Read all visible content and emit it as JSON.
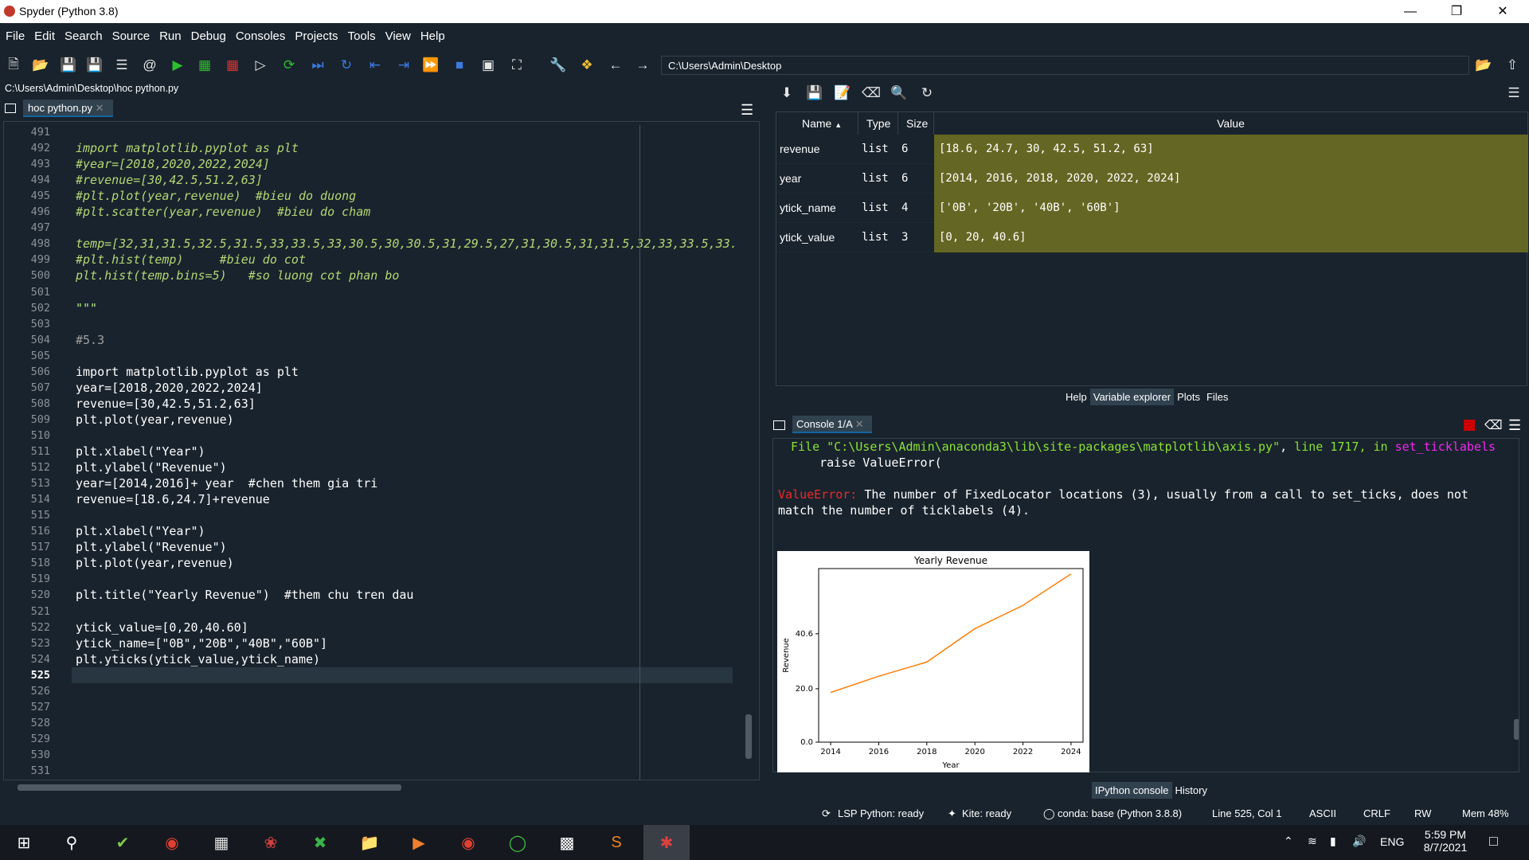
{
  "window": {
    "title": "Spyder (Python 3.8)",
    "minimize": "—",
    "restore": "❐",
    "close": "✕"
  },
  "menu": [
    "File",
    "Edit",
    "Search",
    "Source",
    "Run",
    "Debug",
    "Consoles",
    "Projects",
    "Tools",
    "View",
    "Help"
  ],
  "toolbar": {
    "path": "C:\\Users\\Admin\\Desktop"
  },
  "editor": {
    "file_path": "C:\\Users\\Admin\\Desktop\\hoc python.py",
    "tab_label": "hoc python.py",
    "line_numbers": [
      "491",
      "492",
      "493",
      "494",
      "495",
      "496",
      "497",
      "498",
      "499",
      "500",
      "501",
      "502",
      "503",
      "504",
      "505",
      "506",
      "507",
      "508",
      "509",
      "510",
      "511",
      "512",
      "513",
      "514",
      "515",
      "516",
      "517",
      "518",
      "519",
      "520",
      "521",
      "522",
      "523",
      "524",
      "525",
      "526",
      "527",
      "528",
      "529",
      "530",
      "531"
    ],
    "current_line": "525",
    "lines": [
      {
        "n": "492",
        "text": "import matplotlib.pyplot as plt",
        "style": "it"
      },
      {
        "n": "493",
        "text": "#year=[2018,2020,2022,2024]",
        "style": "it"
      },
      {
        "n": "494",
        "text": "#revenue=[30,42.5,51.2,63]",
        "style": "it"
      },
      {
        "n": "495",
        "text": "#plt.plot(year,revenue)  #bieu do duong",
        "style": "it"
      },
      {
        "n": "496",
        "text": "#plt.scatter(year,revenue)  #bieu do cham",
        "style": "it"
      },
      {
        "n": "498",
        "text": "temp=[32,31,31.5,32.5,31.5,33,33.5,33,30.5,30,30.5,31,29.5,27,31,30.5,31,31.5,32,33,33.5,33.",
        "style": "it"
      },
      {
        "n": "499",
        "text": "#plt.hist(temp)     #bieu do cot",
        "style": "it"
      },
      {
        "n": "500",
        "text": "plt.hist(temp.bins=5)   #so luong cot phan bo",
        "style": "it"
      },
      {
        "n": "502",
        "text": "\"\"\"",
        "style": "st"
      },
      {
        "n": "504",
        "text": "#5.3",
        "style": "cm"
      },
      {
        "n": "506",
        "text": "import matplotlib.pyplot as plt",
        "style": "code"
      },
      {
        "n": "507",
        "text": "year=[2018,2020,2022,2024]",
        "style": "code"
      },
      {
        "n": "508",
        "text": "revenue=[30,42.5,51.2,63]",
        "style": "code"
      },
      {
        "n": "509",
        "text": "plt.plot(year,revenue)",
        "style": "code"
      },
      {
        "n": "511",
        "text": "plt.xlabel(\"Year\")",
        "style": "code"
      },
      {
        "n": "512",
        "text": "plt.ylabel(\"Revenue\")",
        "style": "code"
      },
      {
        "n": "513",
        "text": "year=[2014,2016]+ year  #chen them gia tri",
        "style": "code"
      },
      {
        "n": "514",
        "text": "revenue=[18.6,24.7]+revenue",
        "style": "code"
      },
      {
        "n": "516",
        "text": "plt.xlabel(\"Year\")",
        "style": "code"
      },
      {
        "n": "517",
        "text": "plt.ylabel(\"Revenue\")",
        "style": "code"
      },
      {
        "n": "518",
        "text": "plt.plot(year,revenue)",
        "style": "code"
      },
      {
        "n": "520",
        "text": "plt.title(\"Yearly Revenue\")  #them chu tren dau",
        "style": "code"
      },
      {
        "n": "522",
        "text": "ytick_value=[0,20,40.60]",
        "style": "code"
      },
      {
        "n": "523",
        "text": "ytick_name=[\"0B\",\"20B\",\"40B\",\"60B\"]",
        "style": "code"
      },
      {
        "n": "524",
        "text": "plt.yticks(ytick_value,ytick_name)",
        "style": "code"
      }
    ]
  },
  "variable_explorer": {
    "headers": {
      "name": "Name",
      "type": "Type",
      "size": "Size",
      "value": "Value"
    },
    "rows": [
      {
        "name": "revenue",
        "type": "list",
        "size": "6",
        "value": "[18.6, 24.7, 30, 42.5, 51.2, 63]"
      },
      {
        "name": "year",
        "type": "list",
        "size": "6",
        "value": "[2014, 2016, 2018, 2020, 2022, 2024]"
      },
      {
        "name": "ytick_name",
        "type": "list",
        "size": "4",
        "value": "['0B', '20B', '40B', '60B']"
      },
      {
        "name": "ytick_value",
        "type": "list",
        "size": "3",
        "value": "[0, 20, 40.6]"
      }
    ],
    "tabs": [
      "Help",
      "Variable explorer",
      "Plots",
      "Files"
    ]
  },
  "console": {
    "tab_label": "Console 1/A",
    "file_prefix": "File ",
    "file_path": "\"C:\\Users\\Admin\\anaconda3\\lib\\site-packages\\matplotlib\\axis.py\"",
    "line_sep": ", ",
    "line_text": "line 1717",
    "in_sep": ", in ",
    "func": "set_ticklabels",
    "raise_line": "    raise ValueError(",
    "error_name": "ValueError:",
    "error_msg": " The number of FixedLocator locations (3), usually from a call to set_ticks, does not",
    "error_msg2": "match the number of ticklabels (4).",
    "tabs": [
      "IPython console",
      "History"
    ]
  },
  "chart_data": {
    "type": "line",
    "title": "Yearly Revenue",
    "xlabel": "Year",
    "ylabel": "Revenue",
    "x": [
      2014,
      2016,
      2018,
      2020,
      2022,
      2024
    ],
    "series": [
      {
        "values": [
          18.6,
          24.7,
          30,
          42.5,
          51.2,
          63
        ],
        "color": "#ff7f0e"
      }
    ],
    "xticks": [
      "2014",
      "2016",
      "2018",
      "2020",
      "2022",
      "2024"
    ],
    "yticks": [
      0,
      20,
      40.6
    ],
    "ytick_labels": [
      "0.0",
      "20.0",
      "40.6"
    ],
    "xlim": [
      2013.5,
      2024.5
    ],
    "ylim": [
      0,
      65
    ],
    "grid": false
  },
  "status": {
    "lsp": "LSP Python: ready",
    "kite": "Kite: ready",
    "conda": "conda: base (Python 3.8.8)",
    "position": "Line 525, Col 1",
    "encoding": "ASCII",
    "eol": "CRLF",
    "rw": "RW",
    "mem": "Mem 48%"
  },
  "taskbar": {
    "lang": "ENG",
    "time": "5:59 PM",
    "date": "8/7/2021"
  }
}
